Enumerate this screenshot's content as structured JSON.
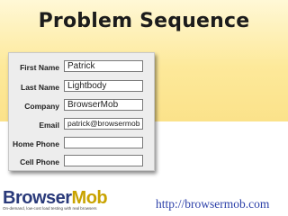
{
  "title": "Problem Sequence",
  "form": {
    "rows": [
      {
        "label": "First Name",
        "value": "Patrick"
      },
      {
        "label": "Last Name",
        "value": "Lightbody"
      },
      {
        "label": "Company",
        "value": "BrowserMob"
      },
      {
        "label": "Email",
        "value": "patrick@browsermob"
      },
      {
        "label": "Home Phone",
        "value": ""
      },
      {
        "label": "Cell Phone",
        "value": ""
      }
    ]
  },
  "footer": {
    "logo_text_a": "Browser",
    "logo_text_b": "Mob",
    "tagline": "On-demand, low-cost load testing with real browsers",
    "url": "http://browsermob.com"
  },
  "colors": {
    "band": "#fde99a",
    "panel": "#ededed",
    "url": "#2b3fa8",
    "logo_dark": "#2a3a7a",
    "logo_accent": "#c9a300"
  }
}
